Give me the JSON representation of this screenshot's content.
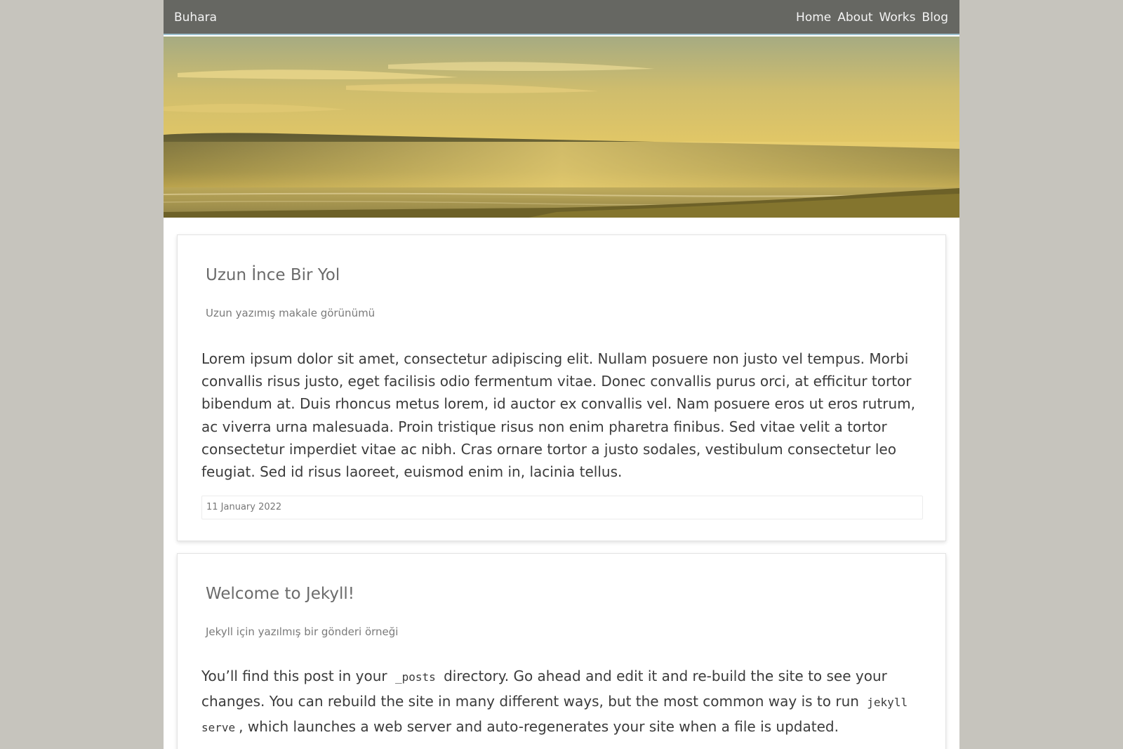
{
  "navbar": {
    "brand": "Buhara",
    "links": [
      "Home",
      "About",
      "Works",
      "Blog"
    ]
  },
  "hero": {
    "image": "golden-coastal-landscape"
  },
  "posts": [
    {
      "title": "Uzun İnce Bir Yol",
      "subtitle": "Uzun yazımış makale görünümü",
      "body": "Lorem ipsum dolor sit amet, consectetur adipiscing elit. Nullam posuere non justo vel tempus. Morbi convallis risus justo, eget facilisis odio fermentum vitae. Donec convallis purus orci, at efficitur tortor bibendum at. Duis rhoncus metus lorem, id auctor ex convallis vel. Nam posuere eros ut eros rutrum, ac viverra urna malesuada. Proin tristique risus non enim pharetra finibus. Sed vitae velit a tortor consectetur imperdiet vitae ac nibh. Cras ornare tortor a justo sodales, vestibulum consectetur leo feugiat. Sed id risus laoreet, euismod enim in, lacinia tellus.",
      "date": "11 January 2022"
    },
    {
      "title": "Welcome to Jekyll!",
      "subtitle": "Jekyll için yazılmış bir gönderi örneği",
      "body_part1": "You’ll find this post in your ",
      "code1": "_posts",
      "body_part2": " directory. Go ahead and edit it and re-build the site to see your changes. You can rebuild the site in many different ways, but the most common way is to run ",
      "code2": "jekyll serve",
      "body_part3": ", which launches a web server and auto-regenerates your site when a file is updated."
    }
  ],
  "colors": {
    "page_background": "#c6c4bd",
    "navbar": "#666762",
    "navbar_border": "#9dc1cf",
    "nav_text": "#f4f4f4"
  }
}
